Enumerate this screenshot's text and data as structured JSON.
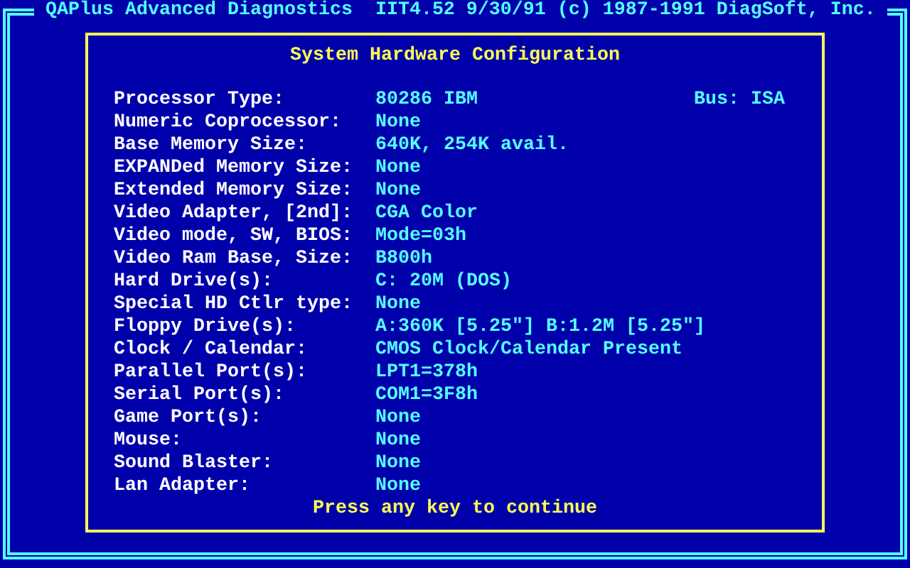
{
  "header": "QAPlus Advanced Diagnostics  IIT4.52 9/30/91 (c) 1987-1991 DiagSoft, Inc.",
  "dialog": {
    "title": "System Hardware Configuration",
    "rows": [
      {
        "label": "Processor Type:",
        "value": "80286 IBM",
        "extra": "Bus: ISA"
      },
      {
        "label": "Numeric Coprocessor:",
        "value": "None"
      },
      {
        "label": "Base Memory Size:",
        "value": "640K, 254K avail."
      },
      {
        "label": "EXPANDed Memory Size:",
        "value": "None"
      },
      {
        "label": "Extended Memory Size:",
        "value": "None"
      },
      {
        "label": "Video Adapter, [2nd]:",
        "value": "CGA Color"
      },
      {
        "label": "Video mode, SW, BIOS:",
        "value": "Mode=03h"
      },
      {
        "label": "Video Ram Base, Size:",
        "value": "B800h"
      },
      {
        "label": "Hard Drive(s):",
        "value": "C: 20M (DOS)"
      },
      {
        "label": "Special HD Ctlr type:",
        "value": "None"
      },
      {
        "label": "Floppy Drive(s):",
        "value": "A:360K [5.25\"] B:1.2M [5.25\"]"
      },
      {
        "label": "Clock / Calendar:",
        "value": "CMOS Clock/Calendar Present"
      },
      {
        "label": "Parallel Port(s):",
        "value": "LPT1=378h"
      },
      {
        "label": "Serial Port(s):",
        "value": "COM1=3F8h"
      },
      {
        "label": "Game Port(s):",
        "value": "None"
      },
      {
        "label": "Mouse:",
        "value": "None"
      },
      {
        "label": "Sound Blaster:",
        "value": "None"
      },
      {
        "label": "Lan Adapter:",
        "value": "None"
      }
    ],
    "prompt": "Press any key to continue"
  }
}
